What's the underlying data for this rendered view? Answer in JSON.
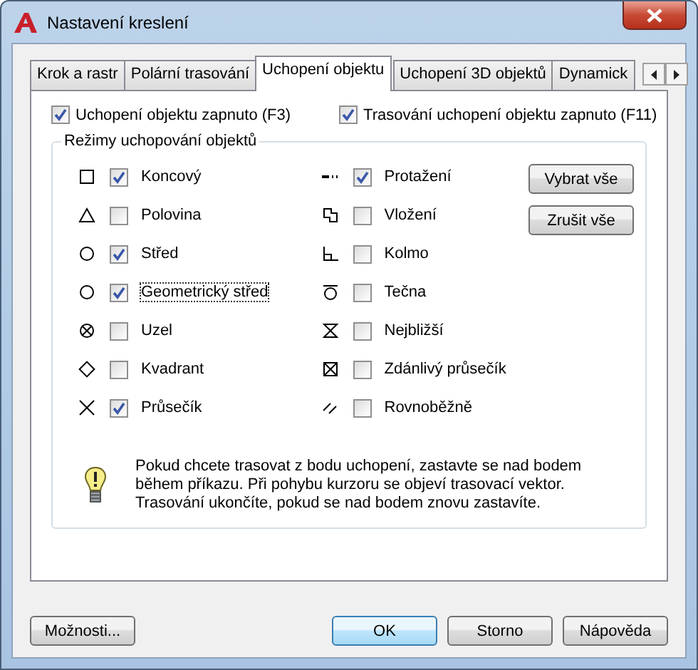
{
  "window": {
    "title": "Nastavení kreslení"
  },
  "tabs": [
    {
      "label": "Krok a rastr",
      "selected": false
    },
    {
      "label": "Polární trasování",
      "selected": false
    },
    {
      "label": "Uchopení objektu",
      "selected": true
    },
    {
      "label": "Uchopení 3D objektů",
      "selected": false
    },
    {
      "label": "Dynamick",
      "selected": false
    }
  ],
  "top_options": [
    {
      "label": "Uchopení objektu zapnuto (F3)",
      "checked": true
    },
    {
      "label": "Trasování uchopení objektu zapnuto (F11)",
      "checked": true
    }
  ],
  "modes_group": {
    "title": "Režimy uchopování objektů",
    "left": [
      {
        "kind": "square",
        "label": "Koncový",
        "checked": true,
        "focused": false
      },
      {
        "kind": "triangle",
        "label": "Polovina",
        "checked": false,
        "focused": false
      },
      {
        "kind": "circle",
        "label": "Střed",
        "checked": true,
        "focused": false
      },
      {
        "kind": "circle",
        "label": "Geometrický střed",
        "checked": true,
        "focused": true
      },
      {
        "kind": "circle-x",
        "label": "Uzel",
        "checked": false,
        "focused": false
      },
      {
        "kind": "diamond",
        "label": "Kvadrant",
        "checked": false,
        "focused": false
      },
      {
        "kind": "x",
        "label": "Průsečík",
        "checked": true,
        "focused": false
      }
    ],
    "right": [
      {
        "kind": "extension",
        "label": "Protažení",
        "checked": true,
        "focused": false
      },
      {
        "kind": "insertion",
        "label": "Vložení",
        "checked": false,
        "focused": false
      },
      {
        "kind": "perpendicular",
        "label": "Kolmo",
        "checked": false,
        "focused": false
      },
      {
        "kind": "tangent",
        "label": "Tečna",
        "checked": false,
        "focused": false
      },
      {
        "kind": "hourglass",
        "label": "Nejbližší",
        "checked": false,
        "focused": false
      },
      {
        "kind": "box-x",
        "label": "Zdánlivý průsečík",
        "checked": false,
        "focused": false
      },
      {
        "kind": "parallel",
        "label": "Rovnoběžně",
        "checked": false,
        "focused": false
      }
    ],
    "buttons": [
      "Vybrat vše",
      "Zrušit vše"
    ]
  },
  "tip": "Pokud chcete trasovat z bodu uchopení, zastavte se nad bodem během příkazu. Při pohybu kurzoru se objeví trasovací vektor. Trasování ukončíte, pokud se nad bodem znovu zastavíte.",
  "footer": {
    "options_button": "Možnosti...",
    "buttons": [
      {
        "label": "OK",
        "default": true
      },
      {
        "label": "Storno",
        "default": false
      },
      {
        "label": "Nápověda",
        "default": false
      }
    ]
  }
}
